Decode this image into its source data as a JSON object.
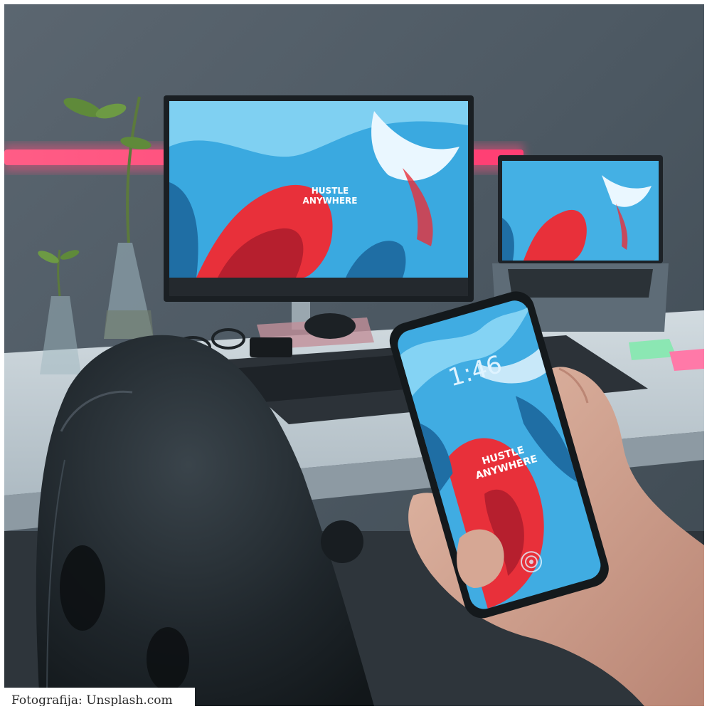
{
  "caption": "Fotografija: Unsplash.com",
  "monitor_wallpaper_text": [
    "HUSTLE",
    "ANYWHERE"
  ],
  "phone_wallpaper_text": [
    "HUSTLE",
    "ANYWHERE"
  ],
  "phone_clock": "1:46",
  "colors": {
    "wall": "#4b5762",
    "neon_strip": "#ff4f7e",
    "wallpaper_blue": "#3aa9e0",
    "wallpaper_red": "#e8303a",
    "desk": "#c9d3d9",
    "chair": "#1d2429"
  }
}
